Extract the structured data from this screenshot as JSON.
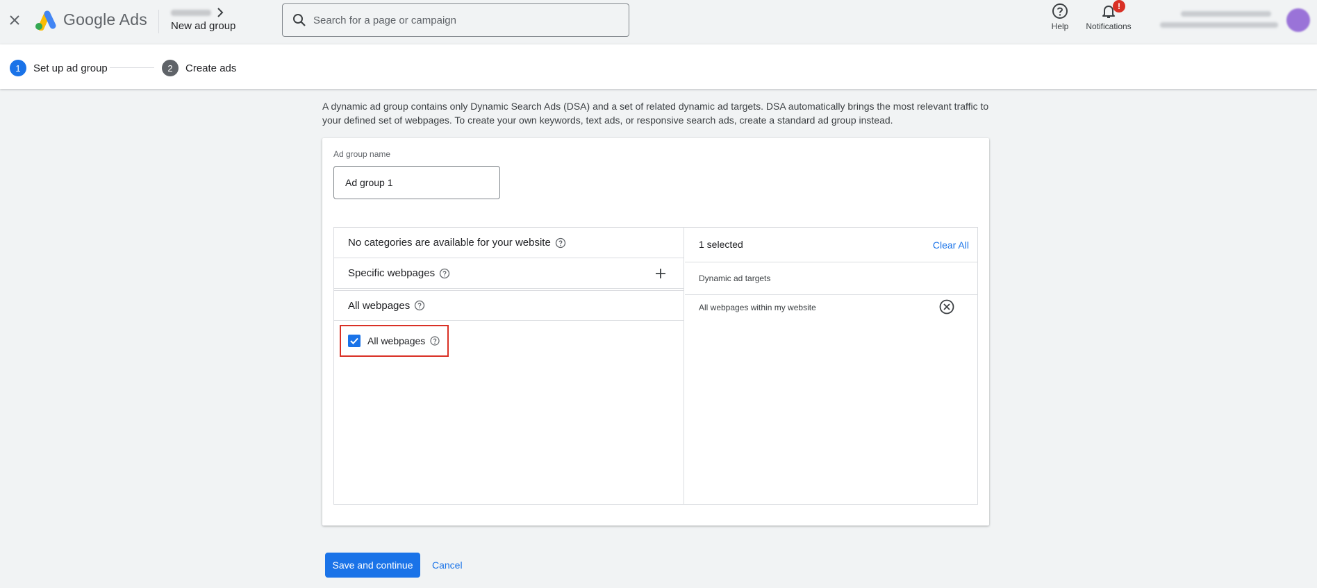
{
  "header": {
    "brand": "Google Ads",
    "breadcrumb_title": "New ad group",
    "search_placeholder": "Search for a page or campaign",
    "help_label": "Help",
    "notifications_label": "Notifications",
    "notifications_badge": "!",
    "icons": {
      "close": "close-icon",
      "logo": "google-ads-logo",
      "chevron": "chevron-right-icon",
      "search": "search-icon",
      "help": "help-icon",
      "notifications": "bell-icon"
    }
  },
  "stepper": {
    "steps": [
      {
        "num": "1",
        "label": "Set up ad group",
        "state": "active"
      },
      {
        "num": "2",
        "label": "Create ads",
        "state": "upcoming"
      }
    ]
  },
  "main": {
    "description": "A dynamic ad group contains only Dynamic Search Ads (DSA) and a set of related dynamic ad targets. DSA automatically brings the most relevant traffic to your defined set of webpages. To create your own keywords, text ads, or responsive search ads, create a standard ad group instead.",
    "ad_group_name_label": "Ad group name",
    "ad_group_name_value": "Ad group 1",
    "left_panel": {
      "categories_row": "No categories are available for your website",
      "specific_row": "Specific webpages",
      "all_row": "All webpages",
      "checkbox_label": "All webpages",
      "checkbox_checked": true
    },
    "right_panel": {
      "selected_count": "1 selected",
      "clear_all": "Clear All",
      "subheader": "Dynamic ad targets",
      "items": [
        "All webpages within my website"
      ]
    }
  },
  "footer": {
    "save_label": "Save and continue",
    "cancel_label": "Cancel"
  },
  "colors": {
    "accent": "#1a73e8",
    "highlight_border": "#d93025",
    "background": "#f1f3f4"
  }
}
